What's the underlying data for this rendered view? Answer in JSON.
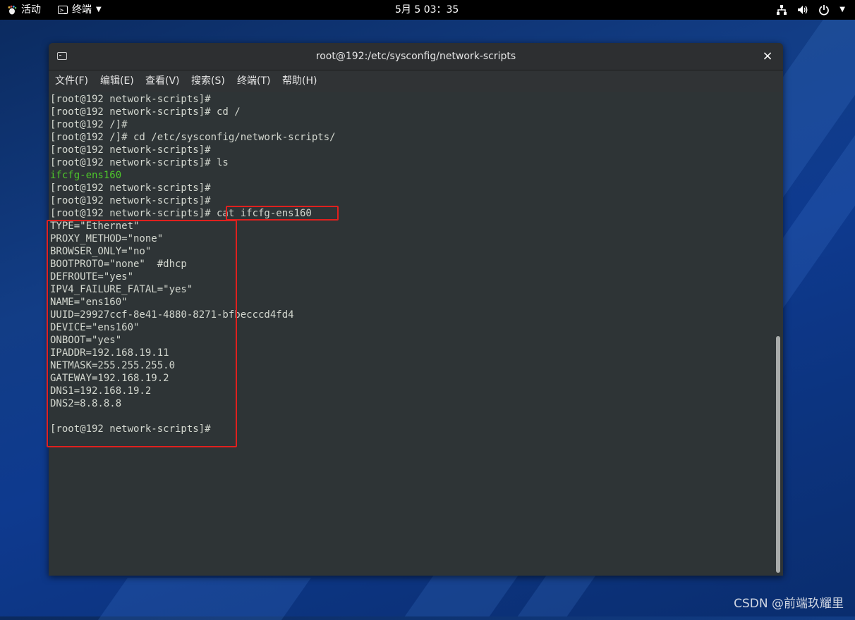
{
  "topbar": {
    "activities_label": "活动",
    "app_label": "终端",
    "clock": "5月 5  03：35"
  },
  "window": {
    "title": "root@192:/etc/sysconfig/network-scripts",
    "close_glyph": "×"
  },
  "menu": [
    {
      "label": "文件(F)"
    },
    {
      "label": "编辑(E)"
    },
    {
      "label": "查看(V)"
    },
    {
      "label": "搜索(S)"
    },
    {
      "label": "终端(T)"
    },
    {
      "label": "帮助(H)"
    }
  ],
  "terminal": {
    "lines": [
      "[root@192 network-scripts]#",
      "[root@192 network-scripts]# cd /",
      "[root@192 /]#",
      "[root@192 /]# cd /etc/sysconfig/network-scripts/",
      "[root@192 network-scripts]#",
      "[root@192 network-scripts]# ls",
      "ifcfg-ens160",
      "[root@192 network-scripts]#",
      "[root@192 network-scripts]#",
      "[root@192 network-scripts]# cat ifcfg-ens160",
      "TYPE=\"Ethernet\"",
      "PROXY_METHOD=\"none\"",
      "BROWSER_ONLY=\"no\"",
      "BOOTPROTO=\"none\"  #dhcp",
      "DEFROUTE=\"yes\"",
      "IPV4_FAILURE_FATAL=\"yes\"",
      "NAME=\"ens160\"",
      "UUID=29927ccf-8e41-4880-8271-bfbecccd4fd4",
      "DEVICE=\"ens160\"",
      "ONBOOT=\"yes\"",
      "IPADDR=192.168.19.11",
      "NETMASK=255.255.255.0",
      "GATEWAY=192.168.19.2",
      "DNS1=192.168.19.2",
      "DNS2=8.8.8.8",
      "",
      "[root@192 network-scripts]#"
    ],
    "ls_output_color": "#4ec82b",
    "text_color": "#d3d7cf",
    "background": "#2e3436"
  },
  "annotations": {
    "highlight_color": "#e0201e"
  },
  "watermark": "CSDN @前端玖耀里",
  "icons": {
    "activities": "gnome-foot-icon",
    "app": "terminal-icon",
    "network": "network-wired-icon",
    "volume": "speaker-icon",
    "power": "power-icon"
  }
}
